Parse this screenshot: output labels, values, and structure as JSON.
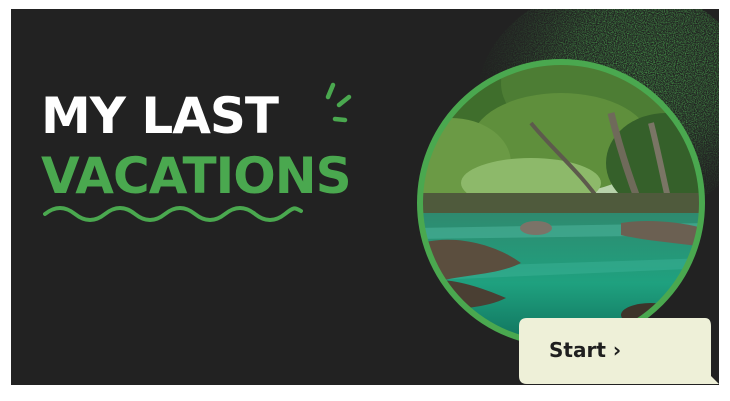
{
  "slide": {
    "title_line1": "MY LAST",
    "title_line2": "VACATIONS",
    "start_label": "Start ›",
    "photo_subject": "forest river landscape"
  },
  "colors": {
    "background": "#222222",
    "accent_green": "#4aa84f",
    "title_white": "#ffffff",
    "button_fill": "#eef0d8",
    "button_text": "#1f1f1f"
  },
  "icons": {
    "sparkle": "sparkle-lines-icon",
    "wave": "wavy-underline-icon",
    "chevron": "chevron-right-icon"
  }
}
